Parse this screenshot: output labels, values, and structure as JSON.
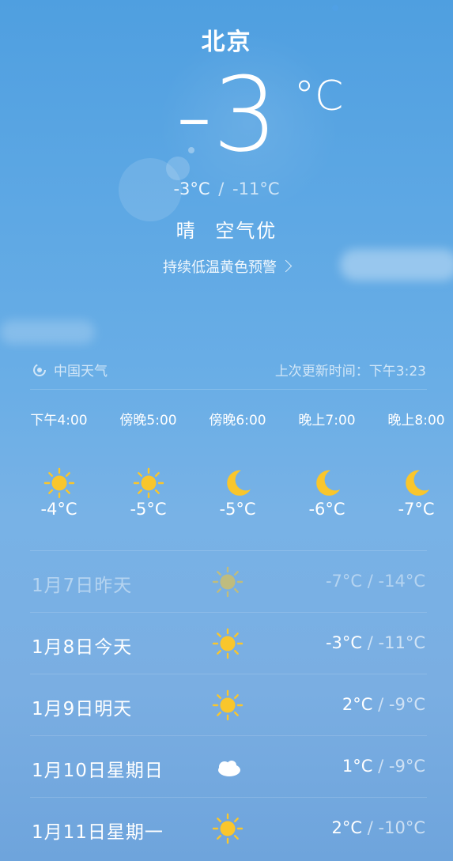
{
  "current": {
    "city": "北京",
    "temp": "-3",
    "unit": "°C",
    "high": "-3°C",
    "low": "-11°C",
    "range_sep": "/",
    "condition": "晴",
    "air": "空气优",
    "warning": "持续低温黄色预警"
  },
  "meta": {
    "provider": "中国天气",
    "updated_label": "上次更新时间：下午3:23"
  },
  "hourly": [
    {
      "time": "下午4:00",
      "icon": "sun-icon",
      "temp": "-4°C"
    },
    {
      "time": "傍晚5:00",
      "icon": "sun-icon",
      "temp": "-5°C"
    },
    {
      "time": "傍晚6:00",
      "icon": "moon-icon",
      "temp": "-5°C"
    },
    {
      "time": "晚上7:00",
      "icon": "moon-icon",
      "temp": "-6°C"
    },
    {
      "time": "晚上8:00",
      "icon": "moon-icon",
      "temp": "-7°C"
    }
  ],
  "daily": [
    {
      "date": "1月7日昨天",
      "icon": "sun-icon",
      "high": "-7°C",
      "low": "-14°C",
      "past": true
    },
    {
      "date": "1月8日今天",
      "icon": "sun-icon",
      "high": "-3°C",
      "low": "-11°C"
    },
    {
      "date": "1月9日明天",
      "icon": "sun-icon",
      "high": "2°C",
      "low": "-9°C"
    },
    {
      "date": "1月10日星期日",
      "icon": "cloud-icon",
      "high": "1°C",
      "low": "-9°C"
    },
    {
      "date": "1月11日星期一",
      "icon": "sun-icon",
      "high": "2°C",
      "low": "-10°C"
    }
  ],
  "colors": {
    "sun": "#f9c62c",
    "moon": "#f9c62c",
    "cloud": "#ffffff"
  }
}
